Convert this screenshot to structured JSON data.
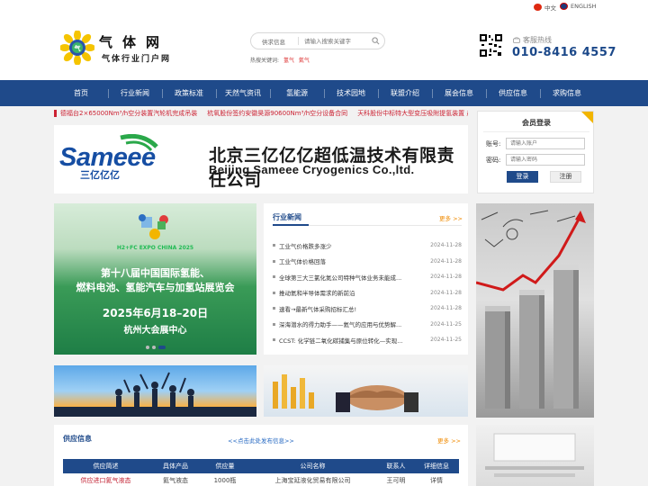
{
  "lang": {
    "cn": "中文",
    "en": "ENGLISH"
  },
  "logo": {
    "title": "气体网",
    "subtitle": "气体行业门户网",
    "mark_text": "气"
  },
  "search": {
    "category": "供求信息",
    "placeholder": "请输入搜索关键字",
    "hot_label": "热搜关键词:",
    "hot": [
      "氢气",
      "氦气"
    ]
  },
  "hotline": {
    "label": "客服热线",
    "number": "010-8416 4557"
  },
  "nav": [
    "首页",
    "行业新闻",
    "政策标准",
    "天然气资讯",
    "氢能源",
    "技术园地",
    "联盟介绍",
    "展会信息",
    "供应信息",
    "求购信息"
  ],
  "ticker": [
    "德福台2×65000Nm³/h空分装置汽轮机完成吊装",
    "杭氧股份签约安徽昊源90600Nm³/h空分设备合同",
    "天科股份中标特大型变压吸附提氢装置 产"
  ],
  "banner": {
    "brand": "Sameee",
    "brand_cn": "三亿亿亿",
    "company_cn": "北京三亿亿亿超低温技术有限责任公司",
    "company_en": "Beijing Sameee Cryogenics Co.,ltd."
  },
  "login": {
    "title": "会员登录",
    "account_label": "账号:",
    "account_placeholder": "请输入账户",
    "password_label": "密码:",
    "password_placeholder": "请输入密码",
    "login_btn": "登录",
    "register_btn": "注册"
  },
  "expo": {
    "badge": "H2+FC EXPO CHINA 2025",
    "line1": "第十八届中国国际氢能、",
    "line2": "燃料电池、氢能汽车与加氢站展览会",
    "date": "2025年6月18–20日",
    "venue": "杭州大会展中心"
  },
  "news": {
    "title": "行业新闻",
    "more": "更多 >>",
    "items": [
      {
        "title": "工业气价格跌多涨少",
        "date": "2024-11-28"
      },
      {
        "title": "工业气体价格回落",
        "date": "2024-11-28"
      },
      {
        "title": "全球第三大三氯化氮公司特种气体业务未能成...",
        "date": "2024-11-28"
      },
      {
        "title": "推动氦和半导体需求的新前沿",
        "date": "2024-11-28"
      },
      {
        "title": "速看→最新气体采购招标汇总!",
        "date": "2024-11-28"
      },
      {
        "title": "深海潜水的得力助手——氦气的应用与优势解...",
        "date": "2024-11-25"
      },
      {
        "title": "CCST: 化学链二氧化碳捕集与原位转化—实现...",
        "date": "2024-11-25"
      }
    ]
  },
  "supply": {
    "title": "供应信息",
    "publish_link": "<<点击此处发布信息>>",
    "more": "更多 >>",
    "columns": [
      "供应简述",
      "具体产品",
      "供应量",
      "公司名称",
      "联系人",
      "详细信息"
    ],
    "row": [
      "供应进口氦气液态",
      "氦气液态",
      "1000瓶",
      "上海宝延液化贸易有限公司",
      "王可明",
      "详情"
    ]
  },
  "colors": {
    "nav_blue": "#1f4a8a",
    "accent_red": "#c22233",
    "accent_orange": "#f08a00",
    "login_corner": "#f2b500"
  }
}
